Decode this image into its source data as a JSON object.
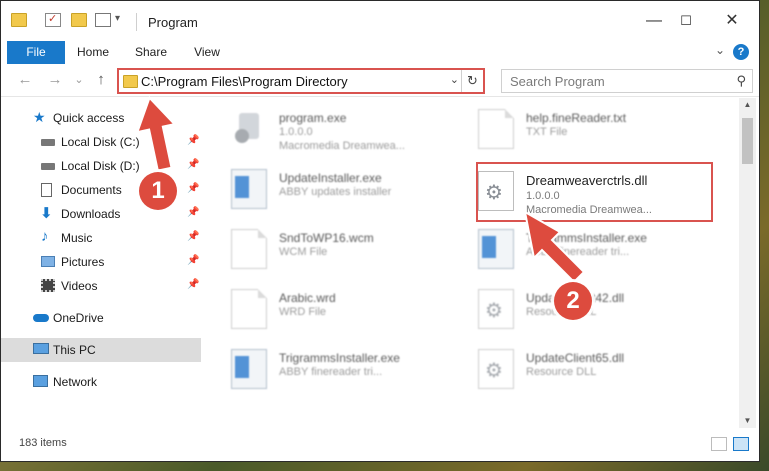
{
  "window": {
    "title": "Program",
    "controls": {
      "minimize": "—",
      "maximize": "☐",
      "close": "✕"
    }
  },
  "ribbon": {
    "tabs": [
      "File",
      "Home",
      "Share",
      "View"
    ],
    "help": "?"
  },
  "nav": {
    "back": "←",
    "forward": "→",
    "recent": "⌄",
    "up": "↑",
    "address": "C:\\Program Files\\Program Directory",
    "dropdown": "⌄",
    "refresh": "↻",
    "search_placeholder": "Search Program",
    "search_icon": "⚲"
  },
  "sidebar": {
    "items": [
      {
        "label": "Quick access",
        "icon": "star-icon",
        "pinned": false
      },
      {
        "label": "Local Disk (C:)",
        "icon": "drive-icon",
        "pinned": true
      },
      {
        "label": "Local Disk (D:)",
        "icon": "drive-icon",
        "pinned": true
      },
      {
        "label": "Documents",
        "icon": "documents-icon",
        "pinned": true
      },
      {
        "label": "Downloads",
        "icon": "download-icon",
        "pinned": true
      },
      {
        "label": "Music",
        "icon": "music-icon",
        "pinned": true
      },
      {
        "label": "Pictures",
        "icon": "pictures-icon",
        "pinned": true
      },
      {
        "label": "Videos",
        "icon": "videos-icon",
        "pinned": true
      },
      {
        "label": "OneDrive",
        "icon": "cloud-icon",
        "pinned": false
      },
      {
        "label": "This PC",
        "icon": "pc-icon",
        "pinned": false
      },
      {
        "label": "Network",
        "icon": "network-icon",
        "pinned": false
      }
    ]
  },
  "files": {
    "left": [
      {
        "name": "program.exe",
        "sub": "1.0.0.0",
        "sub2": "Macromedia Dreamwea...",
        "icon": "exe-icon"
      },
      {
        "name": "UpdateInstaller.exe",
        "sub": "ABBY updates installer",
        "sub2": "",
        "icon": "app-icon"
      },
      {
        "name": "SndToWP16.wcm",
        "sub": "WCM File",
        "sub2": "",
        "icon": "document-icon"
      },
      {
        "name": "Arabic.wrd",
        "sub": "WRD File",
        "sub2": "",
        "icon": "document-icon"
      },
      {
        "name": "TrigrammsInstaller.exe",
        "sub": "ABBY finereader tri...",
        "sub2": "",
        "icon": "app-icon"
      }
    ],
    "right": [
      {
        "name": "help.fineReader.txt",
        "sub": "TXT File",
        "sub2": "",
        "icon": "document-icon"
      },
      {
        "name": "Dreamweaverctrls.dll",
        "sub": "1.0.0.0",
        "sub2": "Macromedia Dreamwea...",
        "icon": "gear-file-icon"
      },
      {
        "name": "TrigrammsInstaller.exe",
        "sub": "ABBY finereader tri...",
        "sub2": "",
        "icon": "app-icon"
      },
      {
        "name": "UpdateClient42.dll",
        "sub": "Resource DLL",
        "sub2": "",
        "icon": "gear-file-icon"
      },
      {
        "name": "UpdateClient65.dll",
        "sub": "Resource DLL",
        "sub2": "",
        "icon": "gear-file-icon"
      }
    ]
  },
  "status": {
    "item_count": "183 items"
  },
  "callouts": {
    "one": "1",
    "two": "2"
  },
  "colors": {
    "accent": "#1979ca",
    "highlight": "#d9534f",
    "callout": "#dd4b3e"
  }
}
